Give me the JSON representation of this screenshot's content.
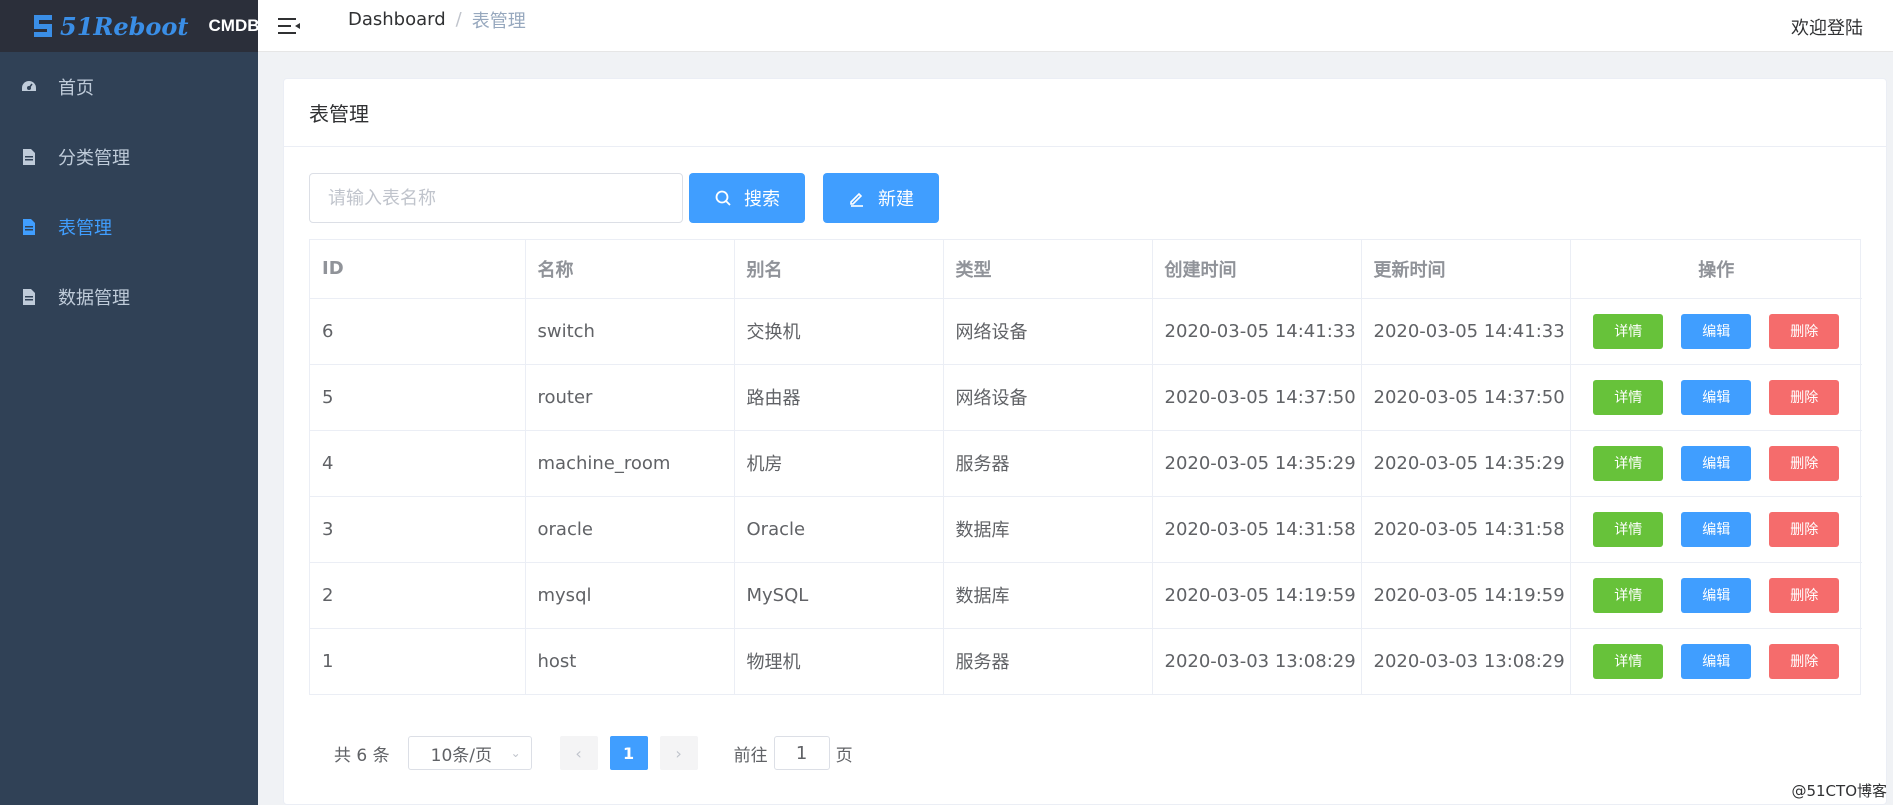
{
  "brand": {
    "logo_text": "51Reboot",
    "app_name": "CMDB"
  },
  "sidebar": {
    "items": [
      {
        "label": "首页",
        "icon": "dashboard-icon",
        "active": false
      },
      {
        "label": "分类管理",
        "icon": "document-icon",
        "active": false
      },
      {
        "label": "表管理",
        "icon": "document-icon",
        "active": true
      },
      {
        "label": "数据管理",
        "icon": "document-icon",
        "active": false
      }
    ]
  },
  "header": {
    "breadcrumb": {
      "home": "Dashboard",
      "separator": "/",
      "current": "表管理"
    },
    "welcome": "欢迎登陆"
  },
  "card": {
    "title": "表管理"
  },
  "toolbar": {
    "search_placeholder": "请输入表名称",
    "search_value": "",
    "search_label": "搜索",
    "new_label": "新建"
  },
  "table": {
    "columns": [
      "ID",
      "名称",
      "别名",
      "类型",
      "创建时间",
      "更新时间",
      "操作"
    ],
    "actions": {
      "detail": "详情",
      "edit": "编辑",
      "delete": "删除"
    },
    "rows": [
      {
        "id": "6",
        "name": "switch",
        "alias": "交换机",
        "type": "网络设备",
        "created": "2020-03-05 14:41:33",
        "updated": "2020-03-05 14:41:33"
      },
      {
        "id": "5",
        "name": "router",
        "alias": "路由器",
        "type": "网络设备",
        "created": "2020-03-05 14:37:50",
        "updated": "2020-03-05 14:37:50"
      },
      {
        "id": "4",
        "name": "machine_room",
        "alias": "机房",
        "type": "服务器",
        "created": "2020-03-05 14:35:29",
        "updated": "2020-03-05 14:35:29"
      },
      {
        "id": "3",
        "name": "oracle",
        "alias": "Oracle",
        "type": "数据库",
        "created": "2020-03-05 14:31:58",
        "updated": "2020-03-05 14:31:58"
      },
      {
        "id": "2",
        "name": "mysql",
        "alias": "MySQL",
        "type": "数据库",
        "created": "2020-03-05 14:19:59",
        "updated": "2020-03-05 14:19:59"
      },
      {
        "id": "1",
        "name": "host",
        "alias": "物理机",
        "type": "服务器",
        "created": "2020-03-03 13:08:29",
        "updated": "2020-03-03 13:08:29"
      }
    ]
  },
  "pagination": {
    "total": "共 6 条",
    "page_size": "10条/页",
    "current_page": "1",
    "goto_label": "前往",
    "goto_value": "1",
    "page_unit": "页"
  },
  "watermark": "@51CTO博客",
  "colors": {
    "sidebar_bg": "#304156",
    "accent": "#409eff",
    "success": "#67c23a",
    "danger": "#f56c6c"
  }
}
